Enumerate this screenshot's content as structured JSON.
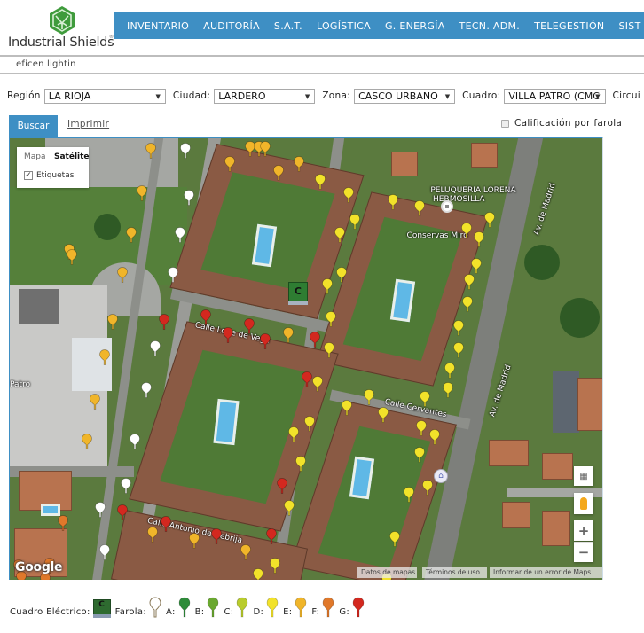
{
  "brand": {
    "name": "Industrial Shields",
    "reg": "®"
  },
  "nav": {
    "items": [
      "INVENTARIO",
      "AUDITORÍA",
      "S.A.T.",
      "LOGÍSTICA",
      "G. ENERGÍA",
      "TECN. ADM.",
      "TELEGESTIÓN",
      "SIST"
    ]
  },
  "subbar": {
    "title": "eficen lightin"
  },
  "filters": {
    "region": {
      "label": "Región",
      "value": "LA RIOJA"
    },
    "ciudad": {
      "label": "Ciudad:",
      "value": "LARDERO"
    },
    "zona": {
      "label": "Zona:",
      "value": "CASCO URBANO"
    },
    "cuadro": {
      "label": "Cuadro:",
      "value": "VILLA PATRO (CMC"
    },
    "circuito": {
      "label": "Circui"
    }
  },
  "tabs": {
    "buscar": "Buscar",
    "imprimir": "Imprimir"
  },
  "calificacion": {
    "label": "Calificación por farola",
    "checked": false
  },
  "map": {
    "type_control": {
      "mapa": "Mapa",
      "satelite": "Satélite",
      "etiquetas": "Etiquetas",
      "etiquetas_checked": true,
      "active": "Satélite"
    },
    "labels": [
      {
        "text": "PELUQUERIA LORENA",
        "mx": 0.708,
        "my": 0.108
      },
      {
        "text": "HERMOSILLA",
        "mx": 0.712,
        "my": 0.128
      },
      {
        "text": "Conservas Miró",
        "mx": 0.668,
        "my": 0.21
      },
      {
        "text": "Av. de Madrid",
        "mx": 0.855,
        "my": 0.15,
        "rot": -72
      },
      {
        "text": "Av. de Madrid",
        "mx": 0.78,
        "my": 0.56,
        "rot": -72
      },
      {
        "text": "Calle Lope de Vega",
        "mx": 0.31,
        "my": 0.43,
        "rot": 12
      },
      {
        "text": "Calle Cervantes",
        "mx": 0.63,
        "my": 0.6,
        "rot": 12
      },
      {
        "text": "Calle Antonio de Nebrija",
        "mx": 0.23,
        "my": 0.875,
        "rot": 12
      },
      {
        "text": "Patro",
        "mx": 0.0,
        "my": 0.545
      }
    ],
    "cuadro_marker": {
      "letter": "C",
      "mx": 0.485,
      "my": 0.345
    },
    "pins": [
      {
        "g": "E",
        "mx": 0.237,
        "my": 0.01
      },
      {
        "g": "W",
        "mx": 0.295,
        "my": 0.01
      },
      {
        "g": "E",
        "mx": 0.405,
        "my": 0.005
      },
      {
        "g": "E",
        "mx": 0.42,
        "my": 0.005
      },
      {
        "g": "E",
        "mx": 0.43,
        "my": 0.005
      },
      {
        "g": "E",
        "mx": 0.37,
        "my": 0.04
      },
      {
        "g": "E",
        "mx": 0.487,
        "my": 0.04
      },
      {
        "g": "E",
        "mx": 0.452,
        "my": 0.06
      },
      {
        "g": "E",
        "mx": 0.222,
        "my": 0.105
      },
      {
        "g": "W",
        "mx": 0.302,
        "my": 0.115
      },
      {
        "g": "D",
        "mx": 0.522,
        "my": 0.08
      },
      {
        "g": "D",
        "mx": 0.57,
        "my": 0.11
      },
      {
        "g": "D",
        "mx": 0.645,
        "my": 0.125
      },
      {
        "g": "D",
        "mx": 0.69,
        "my": 0.14
      },
      {
        "g": "D",
        "mx": 0.58,
        "my": 0.17
      },
      {
        "g": "D",
        "mx": 0.808,
        "my": 0.165
      },
      {
        "g": "W",
        "mx": 0.287,
        "my": 0.2
      },
      {
        "g": "E",
        "mx": 0.205,
        "my": 0.2
      },
      {
        "g": "E",
        "mx": 0.1,
        "my": 0.238
      },
      {
        "g": "E",
        "mx": 0.105,
        "my": 0.25
      },
      {
        "g": "D",
        "mx": 0.555,
        "my": 0.2
      },
      {
        "g": "D",
        "mx": 0.768,
        "my": 0.19
      },
      {
        "g": "D",
        "mx": 0.79,
        "my": 0.21
      },
      {
        "g": "D",
        "mx": 0.785,
        "my": 0.27
      },
      {
        "g": "E",
        "mx": 0.19,
        "my": 0.29
      },
      {
        "g": "W",
        "mx": 0.275,
        "my": 0.29
      },
      {
        "g": "D",
        "mx": 0.558,
        "my": 0.29
      },
      {
        "g": "D",
        "mx": 0.535,
        "my": 0.315
      },
      {
        "g": "D",
        "mx": 0.773,
        "my": 0.305
      },
      {
        "g": "D",
        "mx": 0.77,
        "my": 0.355
      },
      {
        "g": "E",
        "mx": 0.173,
        "my": 0.395
      },
      {
        "g": "G",
        "mx": 0.26,
        "my": 0.395
      },
      {
        "g": "G",
        "mx": 0.33,
        "my": 0.385
      },
      {
        "g": "G",
        "mx": 0.403,
        "my": 0.405
      },
      {
        "g": "G",
        "mx": 0.367,
        "my": 0.425
      },
      {
        "g": "G",
        "mx": 0.43,
        "my": 0.44
      },
      {
        "g": "E",
        "mx": 0.468,
        "my": 0.425
      },
      {
        "g": "G",
        "mx": 0.513,
        "my": 0.435
      },
      {
        "g": "D",
        "mx": 0.54,
        "my": 0.39
      },
      {
        "g": "D",
        "mx": 0.538,
        "my": 0.46
      },
      {
        "g": "D",
        "mx": 0.755,
        "my": 0.41
      },
      {
        "g": "D",
        "mx": 0.755,
        "my": 0.46
      },
      {
        "g": "W",
        "mx": 0.245,
        "my": 0.455
      },
      {
        "g": "E",
        "mx": 0.16,
        "my": 0.475
      },
      {
        "g": "G",
        "mx": 0.5,
        "my": 0.525
      },
      {
        "g": "D",
        "mx": 0.518,
        "my": 0.535
      },
      {
        "g": "D",
        "mx": 0.74,
        "my": 0.505
      },
      {
        "g": "D",
        "mx": 0.738,
        "my": 0.55
      },
      {
        "g": "W",
        "mx": 0.23,
        "my": 0.55
      },
      {
        "g": "E",
        "mx": 0.143,
        "my": 0.575
      },
      {
        "g": "D",
        "mx": 0.605,
        "my": 0.565
      },
      {
        "g": "D",
        "mx": 0.698,
        "my": 0.57
      },
      {
        "g": "D",
        "mx": 0.567,
        "my": 0.59
      },
      {
        "g": "D",
        "mx": 0.628,
        "my": 0.605
      },
      {
        "g": "D",
        "mx": 0.505,
        "my": 0.625
      },
      {
        "g": "D",
        "mx": 0.692,
        "my": 0.635
      },
      {
        "g": "D",
        "mx": 0.715,
        "my": 0.655
      },
      {
        "g": "D",
        "mx": 0.478,
        "my": 0.65
      },
      {
        "g": "W",
        "mx": 0.21,
        "my": 0.665
      },
      {
        "g": "E",
        "mx": 0.13,
        "my": 0.665
      },
      {
        "g": "D",
        "mx": 0.69,
        "my": 0.695
      },
      {
        "g": "D",
        "mx": 0.49,
        "my": 0.715
      },
      {
        "g": "W",
        "mx": 0.195,
        "my": 0.765
      },
      {
        "g": "G",
        "mx": 0.458,
        "my": 0.765
      },
      {
        "g": "D",
        "mx": 0.703,
        "my": 0.77
      },
      {
        "g": "D",
        "mx": 0.672,
        "my": 0.785
      },
      {
        "g": "D",
        "mx": 0.47,
        "my": 0.815
      },
      {
        "g": "W",
        "mx": 0.152,
        "my": 0.82
      },
      {
        "g": "G",
        "mx": 0.19,
        "my": 0.825
      },
      {
        "g": "F",
        "mx": 0.09,
        "my": 0.85
      },
      {
        "g": "G",
        "mx": 0.263,
        "my": 0.852
      },
      {
        "g": "E",
        "mx": 0.24,
        "my": 0.875
      },
      {
        "g": "G",
        "mx": 0.348,
        "my": 0.88
      },
      {
        "g": "E",
        "mx": 0.31,
        "my": 0.89
      },
      {
        "g": "G",
        "mx": 0.44,
        "my": 0.88
      },
      {
        "g": "D",
        "mx": 0.648,
        "my": 0.885
      },
      {
        "g": "E",
        "mx": 0.397,
        "my": 0.915
      },
      {
        "g": "W",
        "mx": 0.16,
        "my": 0.915
      },
      {
        "g": "D",
        "mx": 0.447,
        "my": 0.945
      },
      {
        "g": "D",
        "mx": 0.418,
        "my": 0.97
      },
      {
        "g": "D",
        "mx": 0.635,
        "my": 0.98
      },
      {
        "g": "F",
        "mx": 0.015,
        "my": 0.95
      },
      {
        "g": "F",
        "mx": 0.067,
        "my": 0.945
      },
      {
        "g": "F",
        "mx": 0.02,
        "my": 0.975
      },
      {
        "g": "F",
        "mx": 0.06,
        "my": 0.98
      }
    ],
    "controls": {
      "zoom_in": "+",
      "zoom_out": "−"
    },
    "google": "Google",
    "attribution": [
      "Datos de mapas",
      "Términos de uso",
      "Informar de un error de Maps"
    ]
  },
  "legend": {
    "cuadro_label": "Cuadro Eléctrico:",
    "cuadro_letter": "C",
    "farola_label": "Farola:",
    "grades": [
      {
        "label": "A:",
        "color": "#2e8b3a"
      },
      {
        "label": "B:",
        "color": "#6aa830"
      },
      {
        "label": "C:",
        "color": "#b9cc2c"
      },
      {
        "label": "D:",
        "color": "#f2e22a"
      },
      {
        "label": "E:",
        "color": "#f0b52a"
      },
      {
        "label": "F:",
        "color": "#e0782a"
      },
      {
        "label": "G:",
        "color": "#d3281f"
      }
    ],
    "unrated_color": "#ffffff"
  },
  "pin_colors": {
    "W": "#ffffff",
    "A": "#2e8b3a",
    "B": "#6aa830",
    "C": "#b9cc2c",
    "D": "#f2e22a",
    "E": "#f0b52a",
    "F": "#e0782a",
    "G": "#d3281f"
  }
}
